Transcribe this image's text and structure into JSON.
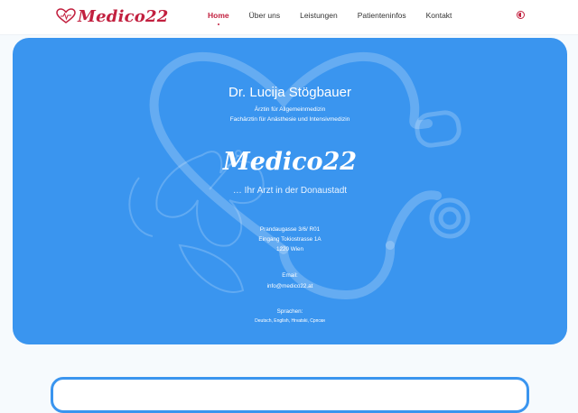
{
  "header": {
    "logo_text": "Medico22",
    "nav": [
      {
        "label": "Home"
      },
      {
        "label": "Über uns"
      },
      {
        "label": "Leistungen"
      },
      {
        "label": "Patienteninfos"
      },
      {
        "label": "Kontakt"
      }
    ],
    "theme_icon": "dark-mode-icon"
  },
  "hero": {
    "doctor_name": "Dr. Lucija Stögbauer",
    "subtitle_1": "Ärztin für Allgemeinmedizin",
    "subtitle_2": "Fachärztin für Anästhesie und Intensivmedizin",
    "brand": "Medico22",
    "tagline": "… Ihr Arzt in der Donaustadt",
    "address_1": "Prandaugasse 3/6/ R01",
    "address_2": "Eingang Tokiostrasse 1A",
    "address_3": "1220 Wien",
    "email_label": "Email:",
    "email": "info@medico22.at",
    "languages_label": "Sprachen:",
    "languages": "Deutsch, English, Hrvatski, Српски"
  },
  "colors": {
    "brand": "#c2203f",
    "hero_bg": "#3a95ef"
  }
}
